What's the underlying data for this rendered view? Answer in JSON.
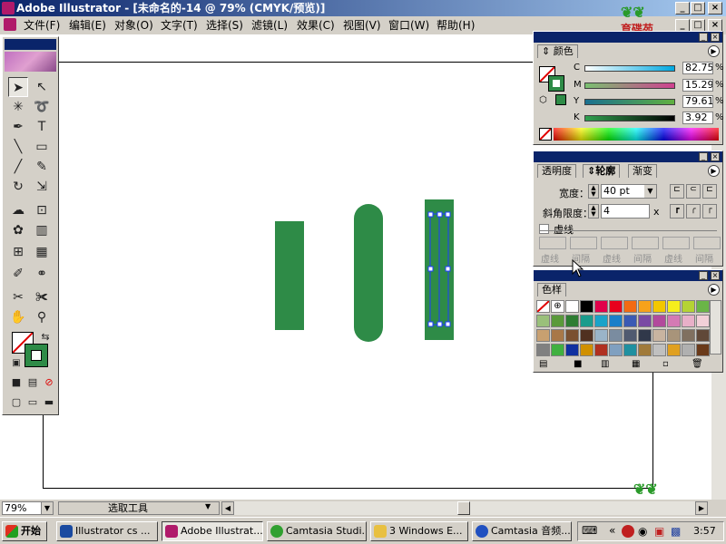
{
  "window": {
    "title": "Adobe Illustrator - [未命名的-14 @ 79% (CMYK/预览)]"
  },
  "menu": [
    "文件(F)",
    "编辑(E)",
    "对象(O)",
    "文字(T)",
    "选择(S)",
    "滤镜(L)",
    "效果(C)",
    "视图(V)",
    "窗口(W)",
    "帮助(H)"
  ],
  "logo_text": "育碟苑",
  "colors": {
    "shape": "#2e8b47",
    "selection": "#1e3cff",
    "title_blue": "#0a246a"
  },
  "tools": [
    "selection-tool",
    "direct-selection-tool",
    "magic-wand-tool",
    "lasso-tool",
    "pen-tool",
    "type-tool",
    "line-tool",
    "rectangle-tool",
    "paintbrush-tool",
    "pencil-tool",
    "rotate-tool",
    "scale-tool",
    "warp-tool",
    "free-transform-tool",
    "symbol-sprayer-tool",
    "column-graph-tool",
    "mesh-tool",
    "gradient-tool",
    "eyedropper-tool",
    "blend-tool",
    "slice-tool",
    "scissors-tool",
    "hand-tool",
    "zoom-tool"
  ],
  "color_panel": {
    "tab": "颜色",
    "channels": [
      {
        "label": "C",
        "value": "82.75"
      },
      {
        "label": "M",
        "value": "15.29"
      },
      {
        "label": "Y",
        "value": "79.61"
      },
      {
        "label": "K",
        "value": "3.92"
      }
    ],
    "pct": "%"
  },
  "stroke_panel": {
    "tabs": [
      "透明度",
      "轮廓",
      "渐变"
    ],
    "weight_label": "宽度：",
    "weight_value": "40 pt",
    "miter_label": "斜角限度：",
    "miter_value": "4",
    "miter_unit": "x",
    "dashed_label": "虚线",
    "dash_labels": [
      "虚线",
      "间隔",
      "虚线",
      "间隔",
      "虚线",
      "间隔"
    ]
  },
  "swatches_panel": {
    "tab": "色样",
    "swatches": [
      [
        "#ffffff",
        "#ffffff",
        "#ffffff",
        "#000000",
        "#e0004a",
        "#e8001c",
        "#f26a12",
        "#f7a21b",
        "#f2c700",
        "#f5ee1c",
        "#b5d334",
        "#6ab547"
      ],
      [
        "#9ac07a",
        "#5a9a3a",
        "#2e7d32",
        "#1a9c8c",
        "#1aa3c9",
        "#1a7fc9",
        "#3a5ab4",
        "#7a4aa4",
        "#b24a9c",
        "#d47ab4",
        "#e8b0c8",
        "#f2d0d8"
      ],
      [
        "#c8a070",
        "#a87848",
        "#7a5030",
        "#503020",
        "#9ab4c8",
        "#7a8ca0",
        "#505a70",
        "#30384a",
        "#c8b4a0",
        "#a8947a",
        "#807060",
        "#604838"
      ],
      [
        "#808080",
        "#40b040",
        "#1030a0",
        "#d09000",
        "#b03020",
        "#80a0c0",
        "#2090a0",
        "#a07a3a",
        "#c0c0c0",
        "#e0a020",
        "#b0b0b0",
        "#6a3a1a"
      ]
    ]
  },
  "status": {
    "zoom": "79%",
    "tool_name": "选取工具"
  },
  "taskbar": {
    "start": "开始",
    "items": [
      "Illustrator cs ...",
      "Adobe Illustrat...",
      "Camtasia Studi...",
      "3 Windows E...",
      "Camtasia 音频..."
    ],
    "clock": "3:57"
  }
}
